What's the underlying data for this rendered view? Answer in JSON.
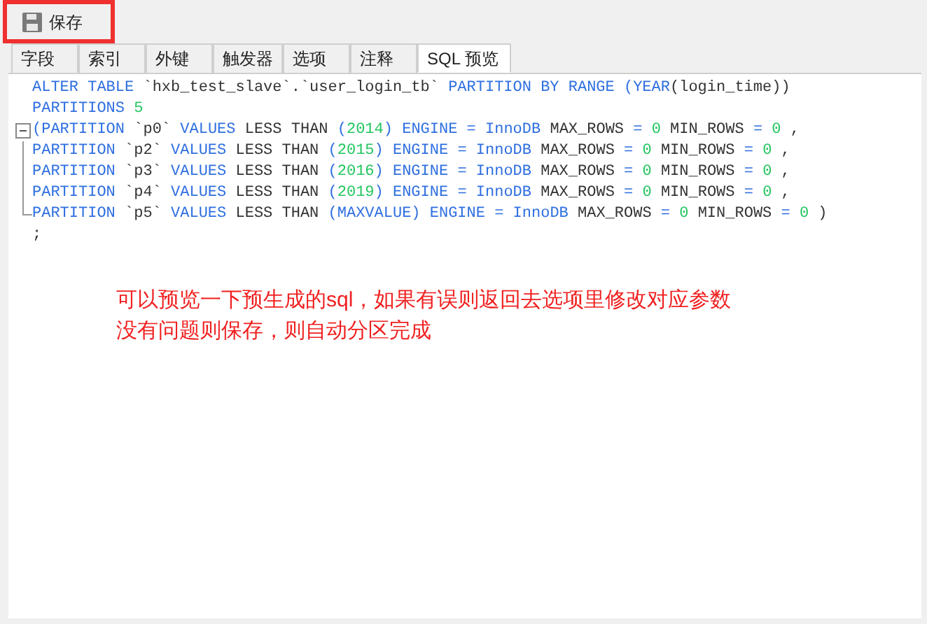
{
  "toolbar": {
    "save_button": {
      "label": "保存",
      "highlighted": true
    }
  },
  "tabs": [
    {
      "label": "字段",
      "selected": false
    },
    {
      "label": "索引",
      "selected": false
    },
    {
      "label": "外键",
      "selected": false
    },
    {
      "label": "触发器",
      "selected": false
    },
    {
      "label": "选项",
      "selected": false
    },
    {
      "label": "注释",
      "selected": false
    },
    {
      "label": "SQL 预览",
      "selected": true
    }
  ],
  "code_lines": [
    {
      "kind": "plain",
      "tokens": [
        {
          "kind": "keyword",
          "text": "ALTER TABLE"
        },
        {
          "kind": "plain",
          "text": " `hxb_test_slave`.`user_login_tb` "
        },
        {
          "kind": "keyword",
          "text": "PARTITION BY RANGE (YEAR"
        },
        {
          "kind": "plain",
          "text": "(login_time))"
        }
      ]
    },
    {
      "kind": "plain",
      "tokens": [
        {
          "kind": "keyword",
          "text": "PARTITIONS "
        },
        {
          "kind": "number",
          "text": "5"
        }
      ]
    },
    {
      "kind": "fold_start",
      "tokens": [
        {
          "kind": "keyword",
          "text": "(PARTITION "
        },
        {
          "kind": "plain",
          "text": "`p0` "
        },
        {
          "kind": "keyword",
          "text": "VALUES "
        },
        {
          "kind": "plain",
          "text": "LESS THAN "
        },
        {
          "kind": "keyword",
          "text": "("
        },
        {
          "kind": "number",
          "text": "2014"
        },
        {
          "kind": "keyword",
          "text": ") ENGINE = InnoDB "
        },
        {
          "kind": "plain",
          "text": "MAX_ROWS "
        },
        {
          "kind": "keyword",
          "text": "= "
        },
        {
          "kind": "number",
          "text": "0"
        },
        {
          "kind": "plain",
          "text": " MIN_ROWS "
        },
        {
          "kind": "keyword",
          "text": "= "
        },
        {
          "kind": "number",
          "text": "0"
        },
        {
          "kind": "plain",
          "text": " ,"
        }
      ]
    },
    {
      "kind": "fold_body",
      "tokens": [
        {
          "kind": "keyword",
          "text": "PARTITION "
        },
        {
          "kind": "plain",
          "text": "`p2` "
        },
        {
          "kind": "keyword",
          "text": "VALUES "
        },
        {
          "kind": "plain",
          "text": "LESS THAN "
        },
        {
          "kind": "keyword",
          "text": "("
        },
        {
          "kind": "number",
          "text": "2015"
        },
        {
          "kind": "keyword",
          "text": ") ENGINE = InnoDB "
        },
        {
          "kind": "plain",
          "text": "MAX_ROWS "
        },
        {
          "kind": "keyword",
          "text": "= "
        },
        {
          "kind": "number",
          "text": "0"
        },
        {
          "kind": "plain",
          "text": " MIN_ROWS "
        },
        {
          "kind": "keyword",
          "text": "= "
        },
        {
          "kind": "number",
          "text": "0"
        },
        {
          "kind": "plain",
          "text": " ,"
        }
      ]
    },
    {
      "kind": "fold_body",
      "tokens": [
        {
          "kind": "keyword",
          "text": "PARTITION "
        },
        {
          "kind": "plain",
          "text": "`p3` "
        },
        {
          "kind": "keyword",
          "text": "VALUES "
        },
        {
          "kind": "plain",
          "text": "LESS THAN "
        },
        {
          "kind": "keyword",
          "text": "("
        },
        {
          "kind": "number",
          "text": "2016"
        },
        {
          "kind": "keyword",
          "text": ") ENGINE = InnoDB "
        },
        {
          "kind": "plain",
          "text": "MAX_ROWS "
        },
        {
          "kind": "keyword",
          "text": "= "
        },
        {
          "kind": "number",
          "text": "0"
        },
        {
          "kind": "plain",
          "text": " MIN_ROWS "
        },
        {
          "kind": "keyword",
          "text": "= "
        },
        {
          "kind": "number",
          "text": "0"
        },
        {
          "kind": "plain",
          "text": " ,"
        }
      ]
    },
    {
      "kind": "fold_body",
      "tokens": [
        {
          "kind": "keyword",
          "text": "PARTITION "
        },
        {
          "kind": "plain",
          "text": "`p4` "
        },
        {
          "kind": "keyword",
          "text": "VALUES "
        },
        {
          "kind": "plain",
          "text": "LESS THAN "
        },
        {
          "kind": "keyword",
          "text": "("
        },
        {
          "kind": "number",
          "text": "2019"
        },
        {
          "kind": "keyword",
          "text": ") ENGINE = InnoDB "
        },
        {
          "kind": "plain",
          "text": "MAX_ROWS "
        },
        {
          "kind": "keyword",
          "text": "= "
        },
        {
          "kind": "number",
          "text": "0"
        },
        {
          "kind": "plain",
          "text": " MIN_ROWS "
        },
        {
          "kind": "keyword",
          "text": "= "
        },
        {
          "kind": "number",
          "text": "0"
        },
        {
          "kind": "plain",
          "text": " ,"
        }
      ]
    },
    {
      "kind": "fold_end",
      "tokens": [
        {
          "kind": "keyword",
          "text": "PARTITION "
        },
        {
          "kind": "plain",
          "text": "`p5` "
        },
        {
          "kind": "keyword",
          "text": "VALUES "
        },
        {
          "kind": "plain",
          "text": "LESS THAN "
        },
        {
          "kind": "keyword",
          "text": "(MAXVALUE) ENGINE = InnoDB "
        },
        {
          "kind": "plain",
          "text": "MAX_ROWS "
        },
        {
          "kind": "keyword",
          "text": "= "
        },
        {
          "kind": "number",
          "text": "0"
        },
        {
          "kind": "plain",
          "text": " MIN_ROWS "
        },
        {
          "kind": "keyword",
          "text": "= "
        },
        {
          "kind": "number",
          "text": "0"
        },
        {
          "kind": "plain",
          "text": " )"
        }
      ]
    },
    {
      "kind": "plain",
      "tokens": [
        {
          "kind": "plain",
          "text": ";"
        }
      ]
    }
  ],
  "annotation": [
    "可以预览一下预生成的sql，如果有误则返回去选项里修改对应参数",
    "没有问题则保存，则自动分区完成"
  ]
}
